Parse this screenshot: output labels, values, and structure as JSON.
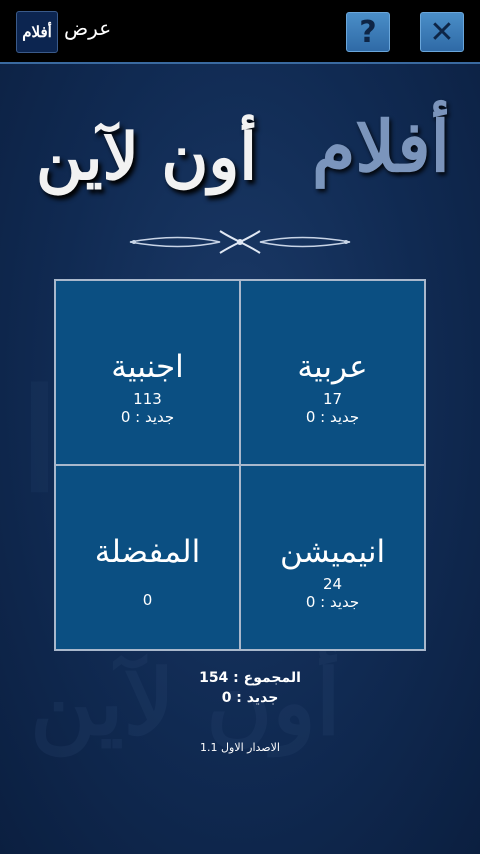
{
  "toolbar": {
    "app_icon_text": "أفلام",
    "title": "عرض",
    "help_label": "?",
    "close_label": "✕"
  },
  "logo": {
    "word1": "أفلام",
    "word2": "أون لآين"
  },
  "categories": [
    {
      "name": "اجنبية",
      "count": "113",
      "new": "جديد : 0"
    },
    {
      "name": "عربية",
      "count": "17",
      "new": "جديد : 0"
    },
    {
      "name": "المفضلة",
      "count": "0",
      "new": ""
    },
    {
      "name": "انيميشن",
      "count": "24",
      "new": "جديد : 0"
    }
  ],
  "totals": {
    "total": "المجموع  :  154",
    "new": "جديد : 0"
  },
  "version": "الاصدار الاول 1.1",
  "colors": {
    "background": "#102a52",
    "tile": "#0b4f82",
    "grid_lines": "#a9b8cc",
    "toolbar_button": "#3a7ab8"
  }
}
